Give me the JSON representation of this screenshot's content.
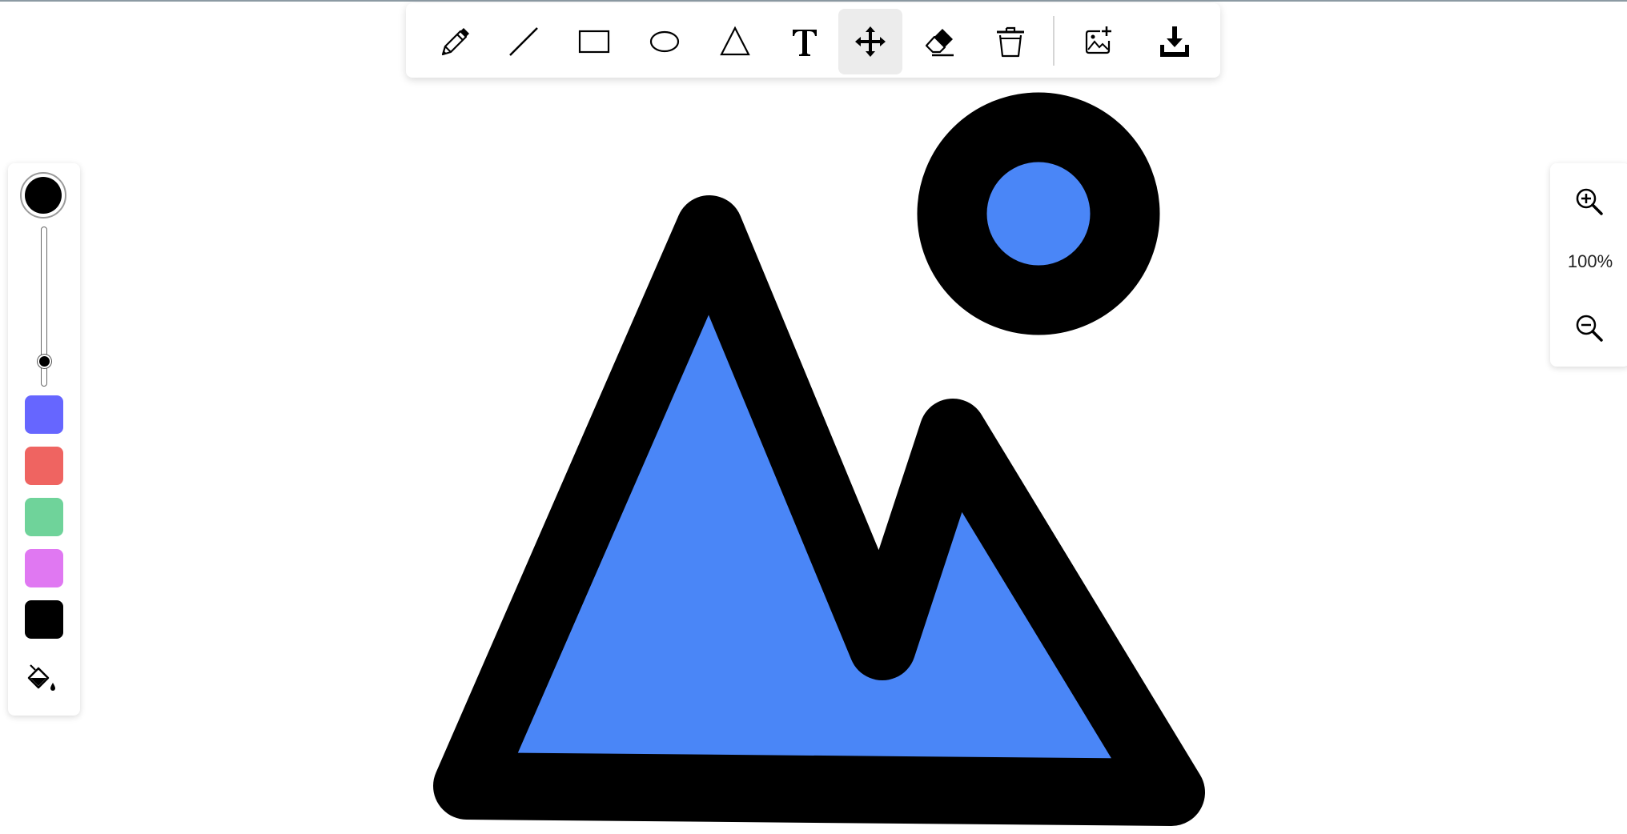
{
  "toolbar": {
    "tools": [
      {
        "name": "pencil",
        "icon": "pencil-icon",
        "active": false
      },
      {
        "name": "line",
        "icon": "line-icon",
        "active": false
      },
      {
        "name": "rectangle",
        "icon": "rectangle-icon",
        "active": false
      },
      {
        "name": "ellipse",
        "icon": "ellipse-icon",
        "active": false
      },
      {
        "name": "triangle",
        "icon": "triangle-icon",
        "active": false
      },
      {
        "name": "text",
        "icon": "text-icon",
        "active": false
      },
      {
        "name": "move",
        "icon": "move-icon",
        "active": true
      },
      {
        "name": "eraser",
        "icon": "eraser-icon",
        "active": false
      },
      {
        "name": "delete",
        "icon": "trash-icon",
        "active": false
      },
      {
        "name": "add-image",
        "icon": "add-image-icon",
        "active": false
      },
      {
        "name": "download",
        "icon": "download-icon",
        "active": false
      }
    ]
  },
  "colors": {
    "current": "#000000",
    "stroke_size_fraction": 0.84,
    "swatches": [
      "#6666ff",
      "#ef6461",
      "#6fd39a",
      "#e078f2",
      "#000000"
    ],
    "fill_icon": "paint-bucket-icon"
  },
  "zoom": {
    "level": "100%",
    "zoom_in_icon": "zoom-in-icon",
    "zoom_out_icon": "zoom-out-icon"
  },
  "drawing": {
    "shapes": [
      {
        "type": "polygon",
        "name": "mountain",
        "fill": "#4a86f7",
        "stroke": "#000000"
      },
      {
        "type": "circle",
        "name": "sun",
        "fill": "#4a86f7",
        "stroke": "#000000"
      }
    ]
  }
}
